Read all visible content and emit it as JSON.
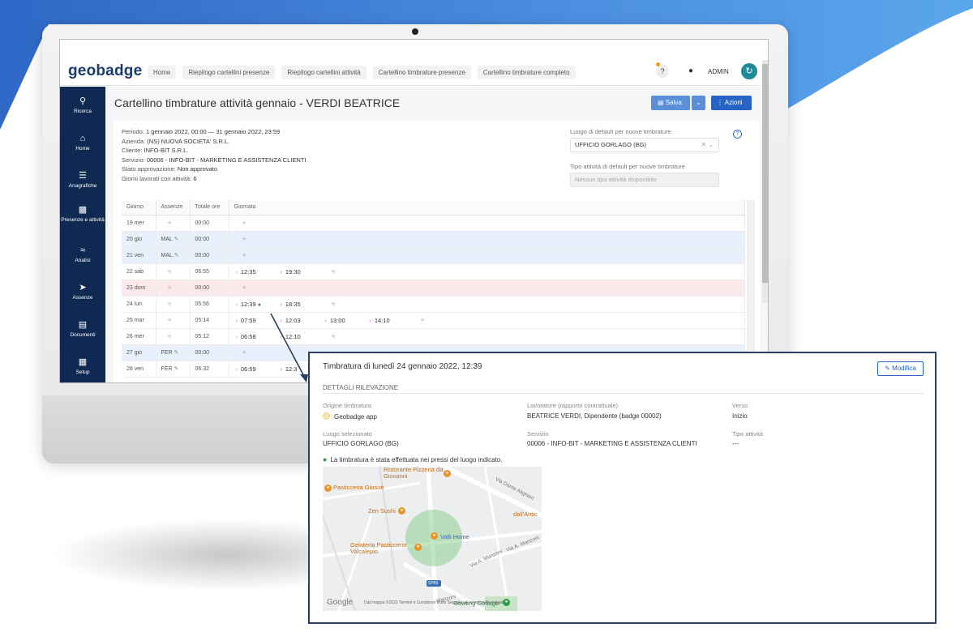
{
  "app": {
    "logo": "geobadge",
    "nav": [
      "Home",
      "Riepilogo cartellini presenze",
      "Riepilogo cartellini attività",
      "Cartellino timbrature presenze",
      "Cartellino timbrature completo"
    ],
    "help_label": "?",
    "user_name": "ADMIN",
    "icons": {
      "user": "user-icon",
      "refresh": "refresh-icon"
    }
  },
  "sidebar": [
    {
      "label": "Ricerca",
      "icon": "search-icon"
    },
    {
      "label": "Home",
      "icon": "home-icon"
    },
    {
      "label": "Anagrafiche",
      "icon": "layers-icon"
    },
    {
      "label": "Presenze e attività",
      "icon": "calendar-icon"
    },
    {
      "label": "Analisi",
      "icon": "chart-icon"
    },
    {
      "label": "Assenze",
      "icon": "plane-icon"
    },
    {
      "label": "Documenti",
      "icon": "folder-icon"
    },
    {
      "label": "Setup",
      "icon": "toolbox-icon"
    }
  ],
  "page": {
    "title": "Cartellino timbrature attività gennaio - VERDI BEATRICE",
    "save_label": "Salva",
    "actions_label": "Azioni"
  },
  "info": {
    "periodo_label": "Periodo:",
    "periodo": "1 gennaio 2022, 00:00 — 31 gennaio 2022, 23:59",
    "azienda_label": "Azienda:",
    "azienda": "(NS) NUOVA SOCIETA' S.R.L.",
    "cliente_label": "Cliente:",
    "cliente": "INFO-BIT S.R.L.",
    "servizio_label": "Servizio:",
    "servizio": "00006 - INFO-BIT - MARKETING E ASSISTENZA CLIENTI",
    "stato_label": "Stato approvazione:",
    "stato": "Non approvato",
    "giorni_label": "Giorni lavorati con attività:",
    "giorni": "6"
  },
  "defaults": {
    "luogo_label": "Luogo di default per nuove timbrature",
    "luogo_value": "UFFICIO GORLAGO (BG)",
    "tipo_label": "Tipo attività di default per nuove timbrature",
    "tipo_value": "Nessun tipo attività disponibile"
  },
  "table": {
    "headers": [
      "Giorno",
      "Assenze",
      "Totale ore",
      "Giornata"
    ],
    "rows": [
      {
        "day": "19 mer",
        "abs": "+",
        "tot": "00:00",
        "style": "",
        "punches": []
      },
      {
        "day": "20 gio",
        "abs": "MAL",
        "tot": "00:00",
        "style": "blue",
        "punches": []
      },
      {
        "day": "21 ven",
        "abs": "MAL",
        "tot": "00:00",
        "style": "blue",
        "punches": []
      },
      {
        "day": "22 sab",
        "abs": "+",
        "tot": "06:55",
        "style": "",
        "punches": [
          {
            "d": "in",
            "t": "12:35"
          },
          {
            "d": "out",
            "t": "19:30"
          }
        ]
      },
      {
        "day": "23 dom",
        "abs": "+",
        "tot": "00:00",
        "style": "pink",
        "punches": []
      },
      {
        "day": "24 lun",
        "abs": "+",
        "tot": "05:56",
        "style": "",
        "punches": [
          {
            "d": "in",
            "t": "12:39",
            "pin": true
          },
          {
            "d": "out",
            "t": "18:35"
          }
        ]
      },
      {
        "day": "25 mar",
        "abs": "+",
        "tot": "05:14",
        "style": "",
        "punches": [
          {
            "d": "in",
            "t": "07:59"
          },
          {
            "d": "out",
            "t": "12:03"
          },
          {
            "d": "in",
            "t": "13:00"
          },
          {
            "d": "out",
            "t": "14:10"
          }
        ]
      },
      {
        "day": "26 mer",
        "abs": "+",
        "tot": "05:12",
        "style": "",
        "punches": [
          {
            "d": "in",
            "t": "06:58"
          },
          {
            "d": "out",
            "t": "12:10"
          }
        ]
      },
      {
        "day": "27 gio",
        "abs": "FER",
        "tot": "00:00",
        "style": "blue",
        "punches": []
      },
      {
        "day": "28 ven",
        "abs": "FER",
        "tot": "06:32",
        "style": "",
        "punches": [
          {
            "d": "in",
            "t": "06:59"
          },
          {
            "d": "out",
            "t": "12:3"
          }
        ]
      }
    ]
  },
  "popup": {
    "title": "Timbratura di lunedì 24 gennaio 2022, 12:39",
    "edit_label": "Modifica",
    "section": "DETTAGLI RILEVAZIONE",
    "fields": {
      "origine_label": "Origine timbratura",
      "origine": "Geobadge app",
      "lavoratore_label": "Lavoratore (rapporto contrattuale)",
      "lavoratore": "BEATRICE VERDI, Dipendente (badge 00002)",
      "verso_label": "Verso",
      "verso": "Inizio",
      "luogo_label": "Luogo selezionato",
      "luogo": "UFFICIO GORLAGO (BG)",
      "servizio_label": "Servizio",
      "servizio": "00006 - INFO-BIT - MARKETING E ASSISTENZA CLIENTI",
      "tipo_label": "Tipo attività",
      "tipo": "---"
    },
    "near_text": "La timbratura è stata effettuata nei pressi del luogo indicato.",
    "map": {
      "places": [
        "Ristorante Pizzeria da Giovanni",
        "Pasticceria Giosuè",
        "Zen Sushi",
        "dall'Antic",
        "Valli Home",
        "Gelateria Pasticceria Valcalepio",
        "Bowling Gorlago"
      ],
      "roads": [
        "Via Dante Alighieri",
        "Via A. Manzoni",
        "Via A. Manzoni",
        "Manzoni",
        "SP89"
      ],
      "google": "Google",
      "footer": "Dati mappa ©2022   Termini e Condizioni d'uso   Segnala un errore nella mappa"
    }
  }
}
